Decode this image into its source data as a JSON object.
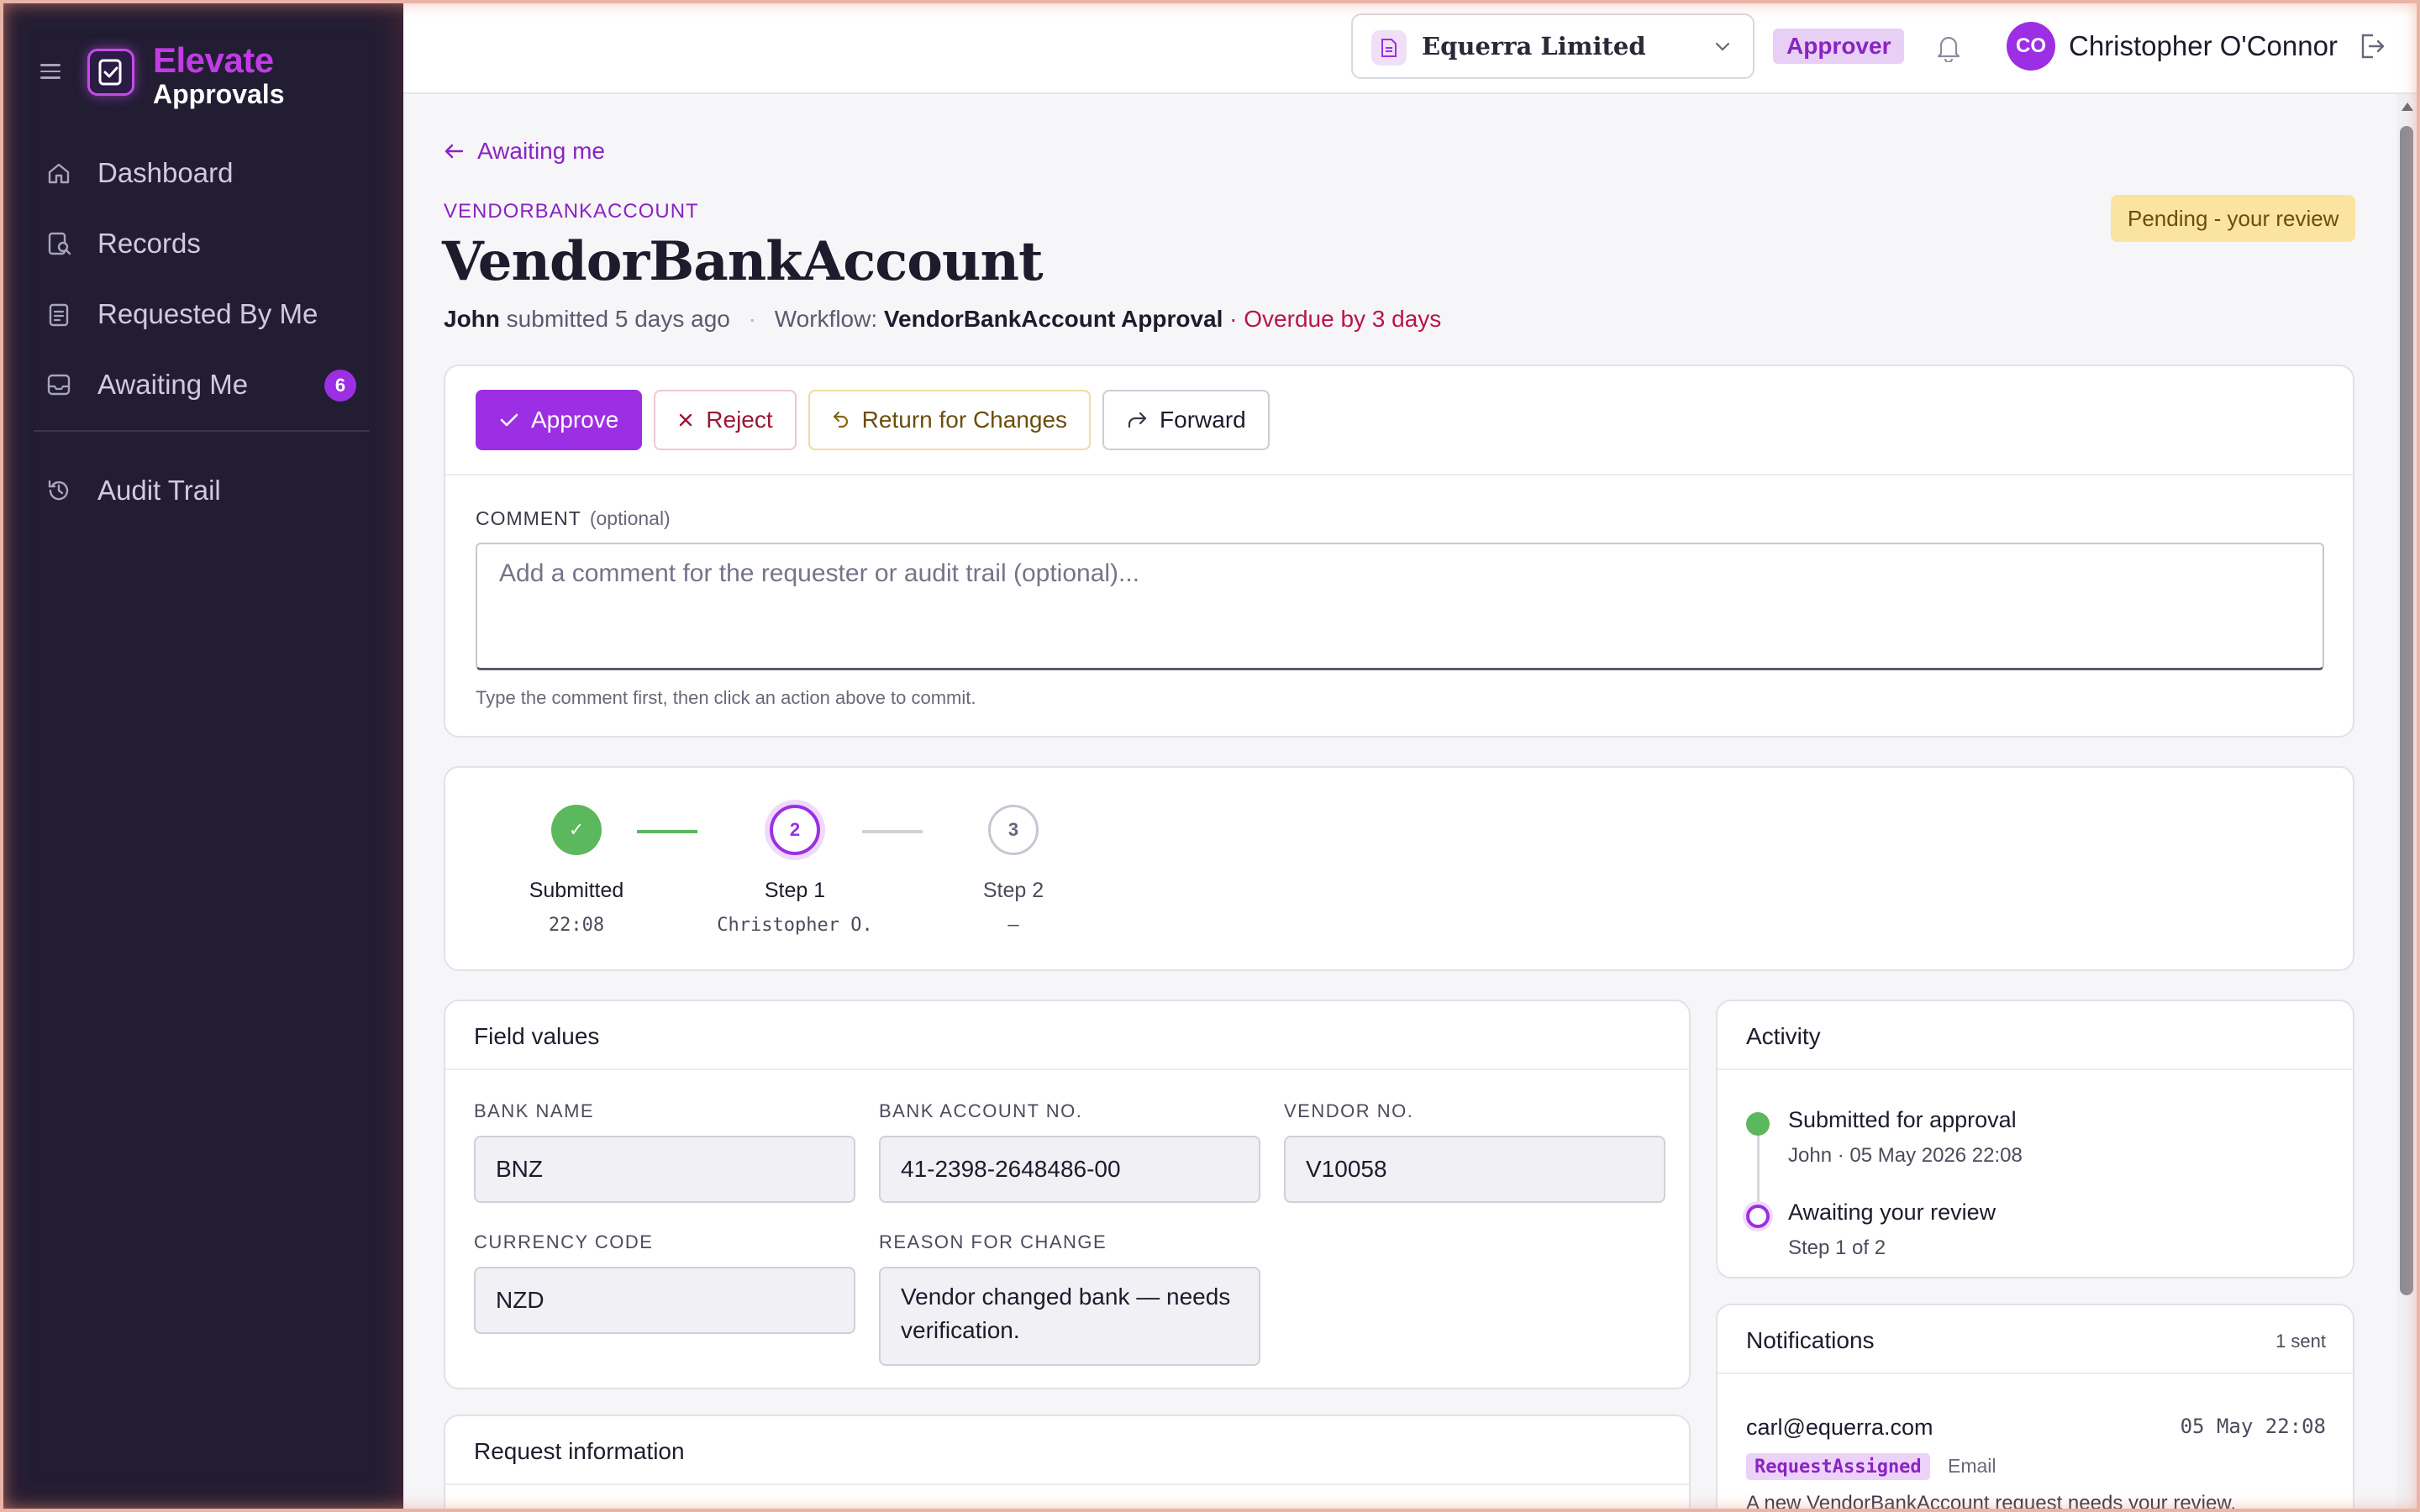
{
  "brand": {
    "line1": "Elevate",
    "line2": "Approvals"
  },
  "sidebar": {
    "items": [
      {
        "label": "Dashboard",
        "icon": "home-icon"
      },
      {
        "label": "Records",
        "icon": "records-icon"
      },
      {
        "label": "Requested By Me",
        "icon": "clipboard-icon"
      },
      {
        "label": "Awaiting Me",
        "icon": "inbox-icon",
        "badge": "6"
      },
      {
        "label": "Audit Trail",
        "icon": "history-icon"
      }
    ]
  },
  "topbar": {
    "org": "Equerra Limited",
    "role": "Approver",
    "user_initials": "CO",
    "user_name": "Christopher O'Connor"
  },
  "breadcrumb": {
    "back_label": "Awaiting me"
  },
  "record": {
    "eyebrow": "VENDORBANKACCOUNT",
    "title": "VendorBankAccount",
    "submitter": "John",
    "submitted_text": "submitted 5 days ago",
    "workflow_label": "Workflow:",
    "workflow_name": "VendorBankAccount Approval",
    "overdue": "· Overdue by 3 days",
    "status": "Pending - your review"
  },
  "actions": {
    "approve": "Approve",
    "reject": "Reject",
    "return": "Return for Changes",
    "forward": "Forward"
  },
  "comment": {
    "label": "COMMENT",
    "optional": "(optional)",
    "placeholder": "Add a comment for the requester or audit trail (optional)...",
    "hint": "Type the comment first, then click an action above to commit."
  },
  "steps": [
    {
      "label": "Submitted",
      "sub": "22:08",
      "marker": "✓",
      "state": "done"
    },
    {
      "label": "Step 1",
      "sub": "Christopher O.",
      "marker": "2",
      "state": "active"
    },
    {
      "label": "Step 2",
      "sub": "–",
      "marker": "3",
      "state": "todo"
    }
  ],
  "fields": {
    "title": "Field values",
    "items": [
      {
        "label": "BANK NAME",
        "value": "BNZ"
      },
      {
        "label": "BANK ACCOUNT NO.",
        "value": "41-2398-2648486-00"
      },
      {
        "label": "VENDOR NO.",
        "value": "V10058"
      },
      {
        "label": "CURRENCY CODE",
        "value": "NZD"
      },
      {
        "label": "REASON FOR CHANGE",
        "value": "Vendor changed bank — needs verification."
      }
    ]
  },
  "activity": {
    "title": "Activity",
    "items": [
      {
        "title": "Submitted for approval",
        "sub": "John · 05 May 2026 22:08"
      },
      {
        "title": "Awaiting your review",
        "sub": "Step 1 of 2"
      }
    ]
  },
  "notifications": {
    "title": "Notifications",
    "count": "1 sent",
    "items": [
      {
        "to": "carl@equerra.com",
        "time": "05 May 22:08",
        "tag": "RequestAssigned",
        "channel": "Email",
        "message": "A new VendorBankAccount request needs your review."
      }
    ]
  },
  "request_info": {
    "title": "Request information"
  },
  "colors": {
    "accent": "#9c2fe4",
    "sidebar": "#221d33",
    "done": "#5cb85c",
    "overdue": "#b8164a",
    "pending_bg": "#fbe3a0"
  }
}
